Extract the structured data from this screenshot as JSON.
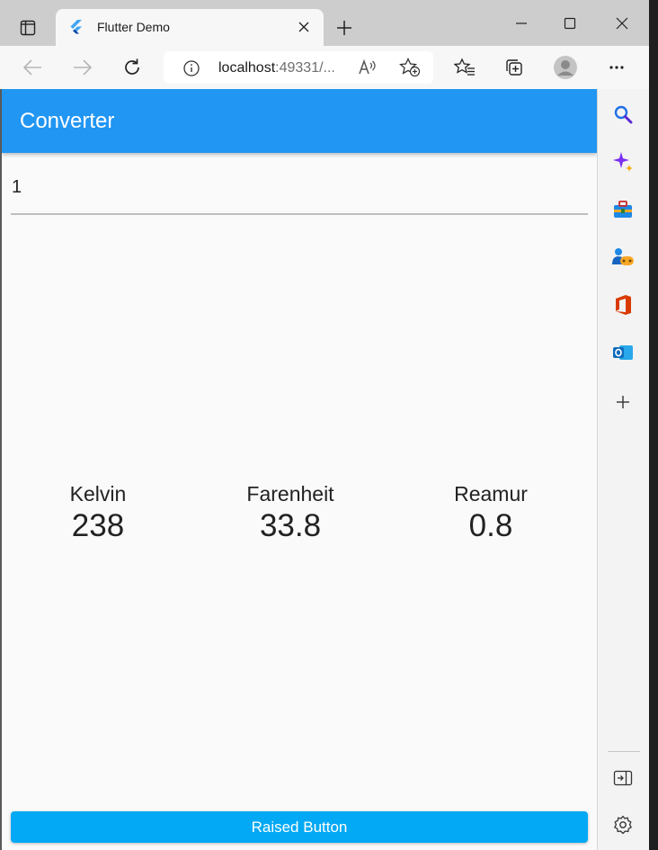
{
  "browser": {
    "tab": {
      "title": "Flutter Demo",
      "favicon": "flutter-logo-icon"
    },
    "address": {
      "host": "localhost",
      "port_path": ":49331/..."
    },
    "toolbar_icons": [
      "back-arrow-icon",
      "forward-arrow-icon",
      "refresh-icon",
      "info-icon",
      "read-aloud-icon",
      "add-favorite-icon",
      "favorites-icon",
      "collections-icon",
      "profile-avatar-icon",
      "more-icon"
    ],
    "window_icons": [
      "minimize-icon",
      "maximize-icon",
      "close-icon"
    ],
    "sidebar_icons": [
      "search-icon",
      "copilot-sparkle-icon",
      "tools-icon",
      "games-icon",
      "office-icon",
      "outlook-icon",
      "add-icon",
      "hide-sidebar-icon",
      "settings-icon"
    ]
  },
  "app": {
    "title": "Converter",
    "input_value": "1",
    "readouts": [
      {
        "label": "Kelvin",
        "value": "238"
      },
      {
        "label": "Farenheit",
        "value": "33.8"
      },
      {
        "label": "Reamur",
        "value": "0.8"
      }
    ],
    "button_label": "Raised Button"
  },
  "colors": {
    "appbar": "#2196f3",
    "button": "#03a9f4",
    "background": "#fafafa"
  }
}
